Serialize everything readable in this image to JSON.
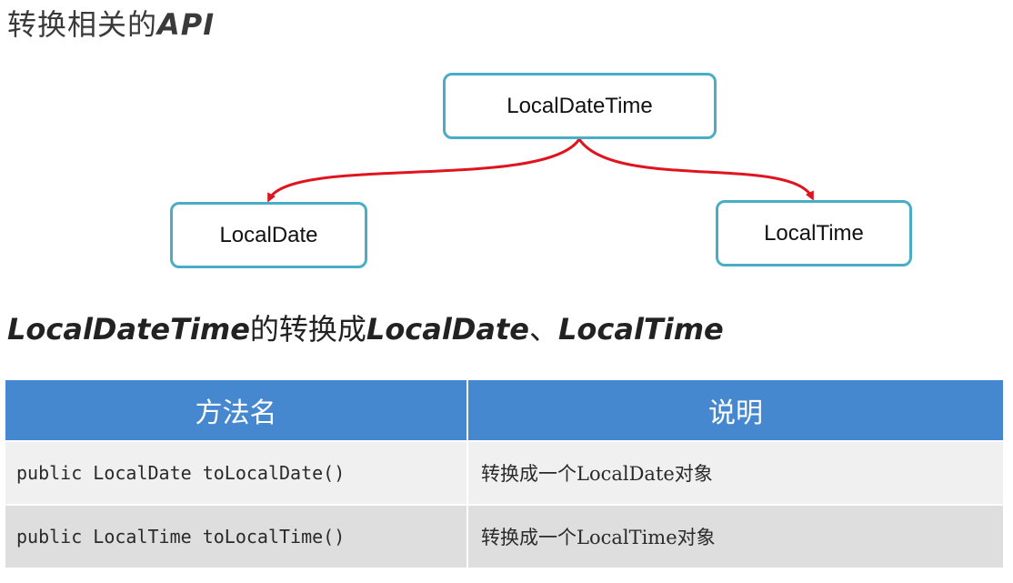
{
  "page_title": {
    "cjk": "转换相关的",
    "latin": "API"
  },
  "diagram": {
    "root": "LocalDateTime",
    "children": [
      "LocalDate",
      "LocalTime"
    ],
    "arrow_color": "#e0141e",
    "box_border_color": "#4aadc6"
  },
  "section_title": {
    "part1": "LocalDateTime",
    "part2": "的转换成",
    "part3": "LocalDate",
    "part4": "、",
    "part5": "LocalTime"
  },
  "table": {
    "header_color": "#4688d0",
    "columns": [
      "方法名",
      "说明"
    ],
    "rows": [
      {
        "method": "public LocalDate toLocalDate()",
        "description": "转换成一个LocalDate对象"
      },
      {
        "method": "public LocalTime toLocalTime()",
        "description": "转换成一个LocalTime对象"
      }
    ]
  }
}
